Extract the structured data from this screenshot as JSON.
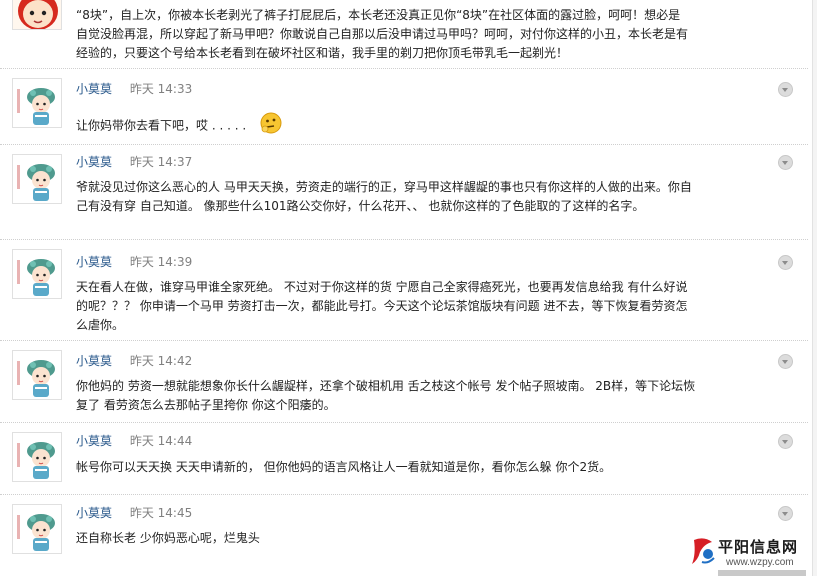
{
  "comments": [
    {
      "avatar": "cartoon-boy-red-hair",
      "user": "",
      "time": "",
      "text": "“8块”，自上次，你被本长老剥光了裤子打屁屁后，本长老还没真正见你“8块”在社区体面的露过脸，呵呵！想必是自觉没脸再混，所以穿起了新马甲吧？你敢说自己自那以后没申请过马甲吗？呵呵，对付你这样的小丑，本长老是有经验的，只要这个号给本长老看到在破坏社区和谐，我手里的剃刀把你顶毛带乳毛一起剃光！"
    },
    {
      "avatar": "cartoon-girl-opera",
      "user": "小莫莫",
      "time": "昨天 14:33",
      "text": "让你妈带你去看下吧，哎      . . . . .",
      "emoji": "thinking-emoji"
    },
    {
      "avatar": "cartoon-girl-opera",
      "user": "小莫莫",
      "time": "昨天 14:37",
      "text": "爷就没见过你这么恶心的人   马甲天天换，劳资走的端行的正，穿马甲这样龌龊的事也只有你这样的人做的出来。你自己有没有穿   自己知道。  像那些什么101路公交你好，什么花开、、  也就你这样的了色能取的了这样的名字。"
    },
    {
      "avatar": "cartoon-girl-opera",
      "user": "小莫莫",
      "time": "昨天 14:39",
      "text": "天在看人在做，谁穿马甲谁全家死绝。   不过对于你这样的货  宁愿自己全家得癌死光，也要再发信息给我  有什么好说的呢？？？    你申请一个马甲  劳资打击一次，都能此号打。今天这个论坛茶馆版块有问题  进不去，等下恢复看劳资怎么虐你。"
    },
    {
      "avatar": "cartoon-girl-opera",
      "user": "小莫莫",
      "time": "昨天 14:42",
      "text": "你他妈的  劳资一想就能想象你长什么龌龊样，还拿个破相机用 舌之枝这个帐号 发个帖子照坡南。  2B样，等下论坛恢复了  看劳资怎么去那帖子里挎你  你这个阳痿的。"
    },
    {
      "avatar": "cartoon-girl-opera",
      "user": "小莫莫",
      "time": "昨天 14:44",
      "text": "帐号你可以天天换  天天申请新的，  但你他妈的语言风格让人一看就知道是你，看你怎么躲  你个2货。"
    },
    {
      "avatar": "cartoon-girl-opera",
      "user": "小莫莫",
      "time": "昨天 14:45",
      "text": "还自称长老   少你妈恶心呢，烂鬼头"
    }
  ],
  "watermark": {
    "logo": "pingyang-logo",
    "title": "平阳信息网",
    "url": "www.wzpy.com"
  },
  "colors": {
    "user_name": "#2b5a8c",
    "time": "#808080",
    "text": "#222222",
    "divider": "#cfcfcf"
  }
}
